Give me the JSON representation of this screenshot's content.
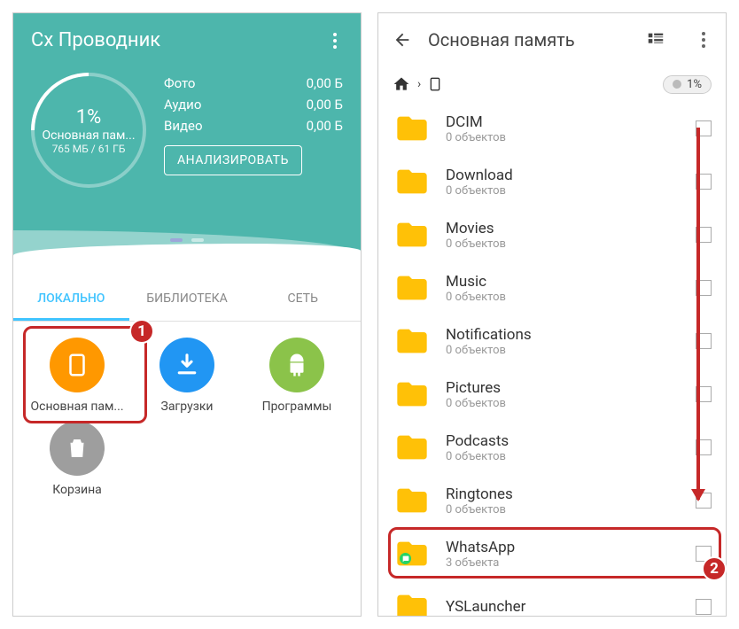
{
  "left": {
    "title": "Cx Проводник",
    "ring": {
      "pct": "1%",
      "label": "Основная пам...",
      "size": "765 МБ / 61 ГБ"
    },
    "stats": [
      {
        "k": "Фото",
        "v": "0,00 Б"
      },
      {
        "k": "Аудио",
        "v": "0,00 Б"
      },
      {
        "k": "Видео",
        "v": "0,00 Б"
      }
    ],
    "analyze": "АНАЛИЗИРОВАТЬ",
    "tabs": [
      "ЛОКАЛЬНО",
      "БИБЛИОТЕКА",
      "СЕТЬ"
    ],
    "items": [
      {
        "label": "Основная пам...",
        "color": "c-or",
        "icon": "tablet"
      },
      {
        "label": "Загрузки",
        "color": "c-bl",
        "icon": "download"
      },
      {
        "label": "Программы",
        "color": "c-gn",
        "icon": "android"
      },
      {
        "label": "Корзина",
        "color": "c-gy",
        "icon": "trash"
      }
    ]
  },
  "right": {
    "title": "Основная память",
    "storagePct": "1%",
    "folders": [
      {
        "name": "DCIM",
        "count": "0 объектов"
      },
      {
        "name": "Download",
        "count": "0 объектов"
      },
      {
        "name": "Movies",
        "count": "0 объектов"
      },
      {
        "name": "Music",
        "count": "0 объектов"
      },
      {
        "name": "Notifications",
        "count": "0 объектов"
      },
      {
        "name": "Pictures",
        "count": "0 объектов"
      },
      {
        "name": "Podcasts",
        "count": "0 объектов"
      },
      {
        "name": "Ringtones",
        "count": "0 объектов"
      },
      {
        "name": "WhatsApp",
        "count": "3 объекта",
        "badge": true
      },
      {
        "name": "YSLauncher",
        "count": ""
      }
    ]
  },
  "annotations": {
    "n1": "1",
    "n2": "2"
  }
}
